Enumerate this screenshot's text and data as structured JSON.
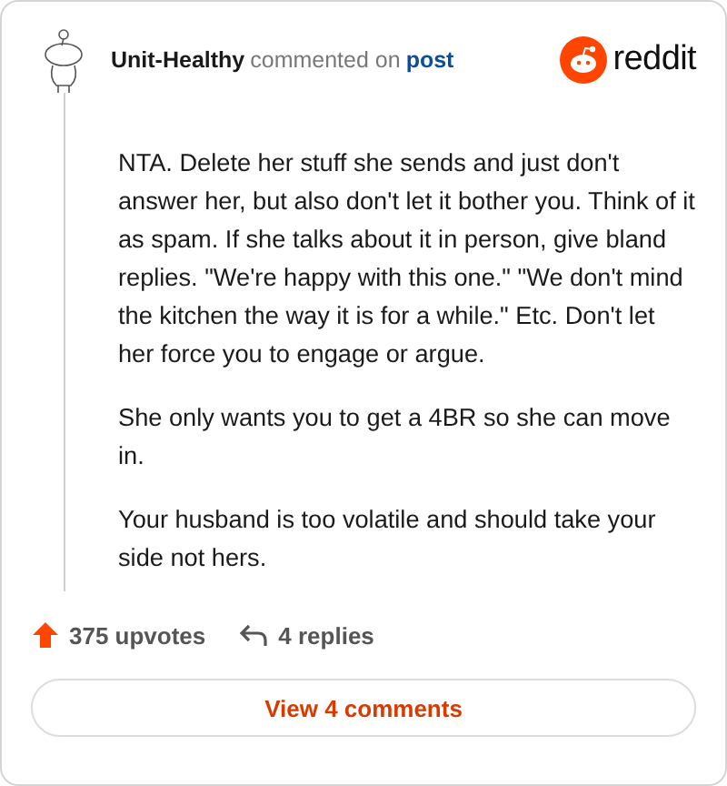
{
  "header": {
    "username": "Unit-Healthy",
    "action": "commented on",
    "link": "post",
    "brand": "reddit"
  },
  "paragraphs": [
    "NTA. Delete her stuff she sends and just don't answer her, but also don't let it bother you. Think of it as spam. If she talks about it in person, give bland replies. \"We're happy with this one.\" \"We don't mind the kitchen the way it is for a while.\" Etc. Don't let her force you to engage or argue.",
    "She only wants you to get a 4BR so she can move in.",
    "Your husband is too volatile and should take your side not hers."
  ],
  "footer": {
    "upvotes": "375 upvotes",
    "replies": "4 replies",
    "button": "View 4 comments"
  }
}
